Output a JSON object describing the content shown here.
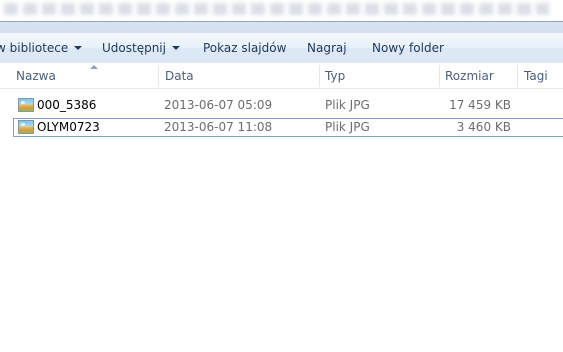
{
  "command_bar": {
    "items": [
      {
        "label": "w bibliotece",
        "has_dropdown": true
      },
      {
        "label": "Udostępnij",
        "has_dropdown": true
      },
      {
        "label": "Pokaz slajdów",
        "has_dropdown": false
      },
      {
        "label": "Nagraj",
        "has_dropdown": false
      },
      {
        "label": "Nowy folder",
        "has_dropdown": false
      }
    ]
  },
  "columns": {
    "name": "Nazwa",
    "date": "Data",
    "type": "Typ",
    "size": "Rozmiar",
    "tags": "Tagi"
  },
  "files": [
    {
      "name": "000_5386",
      "date": "2013-06-07 05:09",
      "type": "Plik JPG",
      "size": "17 459 KB",
      "icon": "jpg-image-icon",
      "selected": false
    },
    {
      "name": "OLYM0723",
      "date": "2013-06-07 11:08",
      "type": "Plik JPG",
      "size": "3 460 KB",
      "icon": "jpg-image-icon",
      "selected": true
    }
  ],
  "colors": {
    "command_text": "#1e395b",
    "header_text": "#4c607a",
    "meta_text": "#6d6d6d",
    "selection_border": "#7da2ce"
  }
}
